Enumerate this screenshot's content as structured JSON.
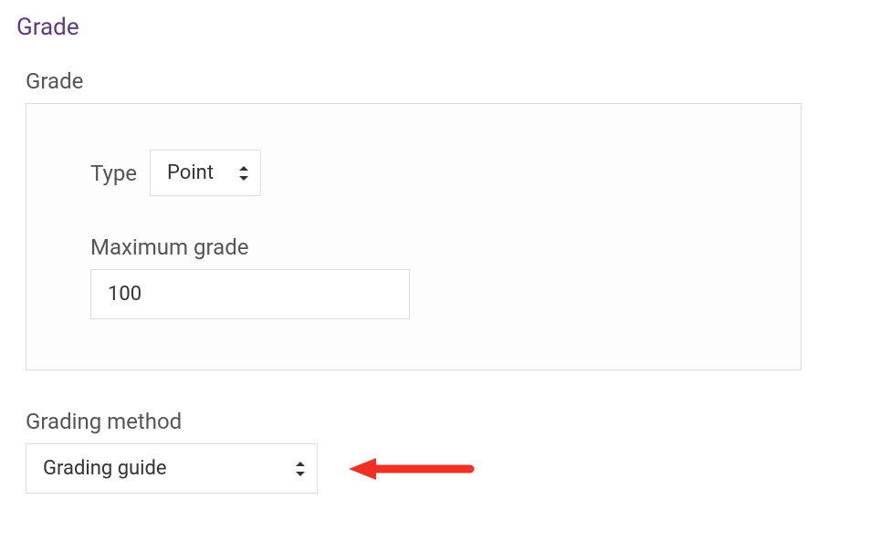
{
  "heading": "Grade",
  "grade": {
    "label": "Grade",
    "type_label": "Type",
    "type_value": "Point",
    "max_label": "Maximum grade",
    "max_value": "100"
  },
  "grading_method": {
    "label": "Grading method",
    "value": "Grading guide"
  }
}
